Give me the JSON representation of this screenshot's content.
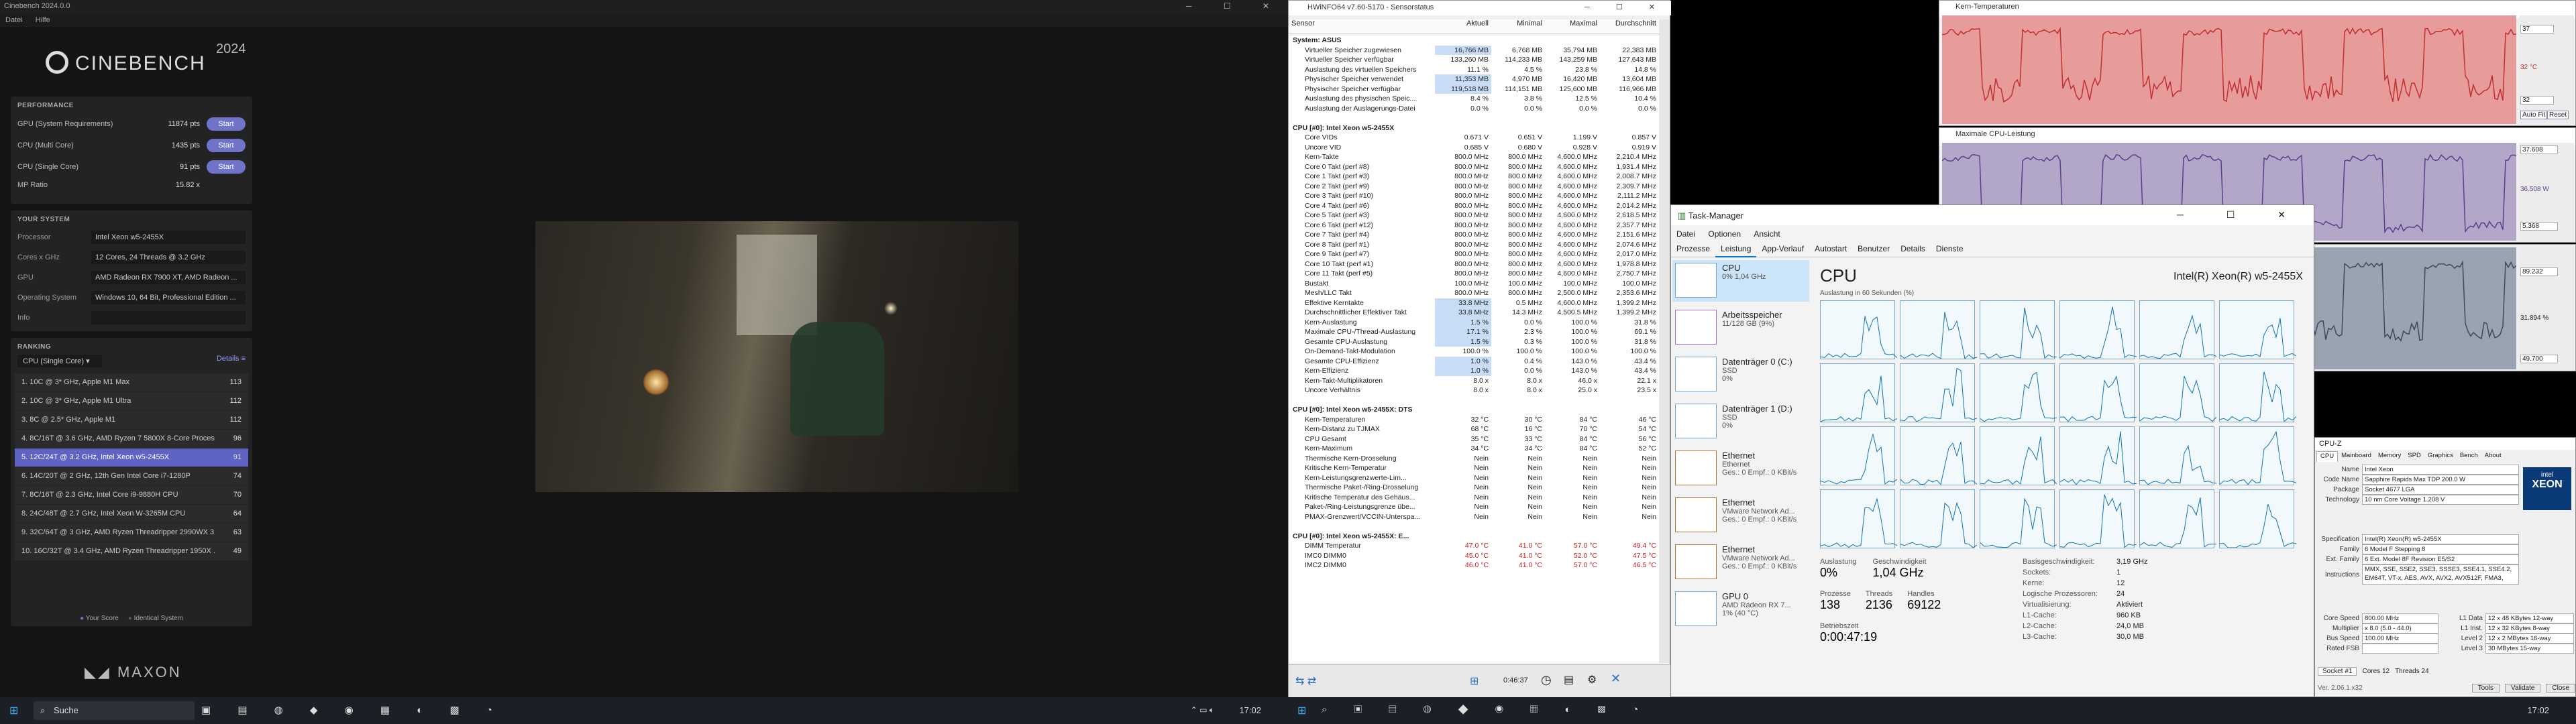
{
  "cinebench": {
    "title": "Cinebench 2024.0.0",
    "menu": [
      "Datei",
      "Hilfe"
    ],
    "logo": "CINEBENCH",
    "year": "2024",
    "performance": {
      "heading": "PERFORMANCE",
      "rows": [
        {
          "label": "GPU (System Requirements)",
          "value": "11874 pts",
          "button": "Start"
        },
        {
          "label": "CPU (Multi Core)",
          "value": "1435 pts",
          "button": "Start"
        },
        {
          "label": "CPU (Single Core)",
          "value": "91 pts",
          "button": "Start"
        },
        {
          "label": "MP Ratio",
          "value": "15.82 x",
          "button": ""
        }
      ]
    },
    "system": {
      "heading": "YOUR SYSTEM",
      "rows": [
        {
          "label": "Processor",
          "value": "Intel Xeon w5-2455X"
        },
        {
          "label": "Cores x GHz",
          "value": "12 Cores, 24 Threads @ 3.2 GHz"
        },
        {
          "label": "GPU",
          "value": "AMD Radeon RX 7900 XT, AMD Radeon ..."
        },
        {
          "label": "Operating System",
          "value": "Windows 10, 64 Bit, Professional Edition ..."
        },
        {
          "label": "Info",
          "value": ""
        }
      ]
    },
    "ranking": {
      "heading": "RANKING",
      "dropdown": "CPU (Single Core)",
      "details": "Details",
      "rows": [
        {
          "name": "1. 10C @ 3* GHz, Apple M1 Max",
          "score": "113"
        },
        {
          "name": "2. 10C @ 3* GHz, Apple M1 Ultra",
          "score": "112"
        },
        {
          "name": "3. 8C @ 2.5* GHz, Apple M1",
          "score": "112"
        },
        {
          "name": "4. 8C/16T @ 3.6 GHz, AMD Ryzen 7 5800X 8-Core Proces...",
          "score": "96"
        },
        {
          "name": "5. 12C/24T @ 3.2 GHz, Intel Xeon w5-2455X",
          "score": "91"
        },
        {
          "name": "6. 14C/20T @ 2 GHz, 12th Gen Intel Core i7-1280P",
          "score": "74"
        },
        {
          "name": "7. 8C/16T @ 2.3 GHz, Intel Core i9-9880H CPU",
          "score": "70"
        },
        {
          "name": "8. 24C/48T @ 2.7 GHz, Intel Xeon W-3265M CPU",
          "score": "64"
        },
        {
          "name": "9. 32C/64T @ 3 GHz, AMD Ryzen Threadripper 2990WX 3...",
          "score": "63"
        },
        {
          "name": "10. 16C/32T @ 3.4 GHz, AMD Ryzen Threadripper 1950X ...",
          "score": "49"
        }
      ],
      "legend_your": "Your Score",
      "legend_identical": "Identical System"
    },
    "brand": "MAXON"
  },
  "hwinfo": {
    "title": "HWiNFO64 v7.60-5170 - Sensorstatus",
    "columns": [
      "Sensor",
      "Aktuell",
      "Minimal",
      "Maximal",
      "Durchschnitt"
    ],
    "rows": [
      {
        "s": "System: ASUS",
        "a": "",
        "mi": "",
        "ma": "",
        "d": "",
        "g": true
      },
      {
        "s": "Virtueller Speicher zugewiesen",
        "a": "16,766 MB",
        "mi": "6,768 MB",
        "ma": "35,794 MB",
        "d": "22,383 MB"
      },
      {
        "s": "Virtueller Speicher verfügbar",
        "a": "133,260 MB",
        "mi": "114,233 MB",
        "ma": "143,259 MB",
        "d": "127,643 MB"
      },
      {
        "s": "Auslastung des virtuellen Speichers",
        "a": "11.1 %",
        "mi": "4.5 %",
        "ma": "23.8 %",
        "d": "14.8 %"
      },
      {
        "s": "Physischer Speicher verwendet",
        "a": "11,353 MB",
        "mi": "4,970 MB",
        "ma": "16,420 MB",
        "d": "13,604 MB"
      },
      {
        "s": "Physischer Speicher verfügbar",
        "a": "119,518 MB",
        "mi": "114,151 MB",
        "ma": "125,600 MB",
        "d": "116,966 MB"
      },
      {
        "s": "Auslastung des physischen Speic...",
        "a": "8.4 %",
        "mi": "3.8 %",
        "ma": "12.5 %",
        "d": "10.4 %"
      },
      {
        "s": "Auslastung der Auslagerungs-Datei",
        "a": "0.0 %",
        "mi": "0.0 %",
        "ma": "0.0 %",
        "d": "0.0 %"
      },
      {
        "s": "",
        "a": "",
        "mi": "",
        "ma": "",
        "d": ""
      },
      {
        "s": "CPU [#0]: Intel Xeon w5-2455X",
        "a": "",
        "mi": "",
        "ma": "",
        "d": "",
        "g": true
      },
      {
        "s": "Core VIDs",
        "a": "0.671 V",
        "mi": "0.651 V",
        "ma": "1.199 V",
        "d": "0.857 V"
      },
      {
        "s": "Uncore VID",
        "a": "0.685 V",
        "mi": "0.680 V",
        "ma": "0.928 V",
        "d": "0.919 V"
      },
      {
        "s": "Kern-Takte",
        "a": "800.0 MHz",
        "mi": "800.0 MHz",
        "ma": "4,600.0 MHz",
        "d": "2,210.4 MHz"
      },
      {
        "s": "Core 0 Takt (perf #8)",
        "a": "800.0 MHz",
        "mi": "800.0 MHz",
        "ma": "4,600.0 MHz",
        "d": "1,931.4 MHz"
      },
      {
        "s": "Core 1 Takt (perf #3)",
        "a": "800.0 MHz",
        "mi": "800.0 MHz",
        "ma": "4,600.0 MHz",
        "d": "2,008.7 MHz"
      },
      {
        "s": "Core 2 Takt (perf #9)",
        "a": "800.0 MHz",
        "mi": "800.0 MHz",
        "ma": "4,600.0 MHz",
        "d": "2,309.7 MHz"
      },
      {
        "s": "Core 3 Takt (perf #10)",
        "a": "800.0 MHz",
        "mi": "800.0 MHz",
        "ma": "4,600.0 MHz",
        "d": "2,111.2 MHz"
      },
      {
        "s": "Core 4 Takt (perf #6)",
        "a": "800.0 MHz",
        "mi": "800.0 MHz",
        "ma": "4,600.0 MHz",
        "d": "2,014.2 MHz"
      },
      {
        "s": "Core 5 Takt (perf #3)",
        "a": "800.0 MHz",
        "mi": "800.0 MHz",
        "ma": "4,600.0 MHz",
        "d": "2,618.5 MHz"
      },
      {
        "s": "Core 6 Takt (perf #12)",
        "a": "800.0 MHz",
        "mi": "800.0 MHz",
        "ma": "4,600.0 MHz",
        "d": "2,357.7 MHz"
      },
      {
        "s": "Core 7 Takt (perf #4)",
        "a": "800.0 MHz",
        "mi": "800.0 MHz",
        "ma": "4,600.0 MHz",
        "d": "2,151.6 MHz"
      },
      {
        "s": "Core 8 Takt (perf #1)",
        "a": "800.0 MHz",
        "mi": "800.0 MHz",
        "ma": "4,600.0 MHz",
        "d": "2,074.6 MHz"
      },
      {
        "s": "Core 9 Takt (perf #7)",
        "a": "800.0 MHz",
        "mi": "800.0 MHz",
        "ma": "4,600.0 MHz",
        "d": "2,017.0 MHz"
      },
      {
        "s": "Core 10 Takt (perf #1)",
        "a": "800.0 MHz",
        "mi": "800.0 MHz",
        "ma": "4,600.0 MHz",
        "d": "1,978.8 MHz"
      },
      {
        "s": "Core 11 Takt (perf #5)",
        "a": "800.0 MHz",
        "mi": "800.0 MHz",
        "ma": "4,600.0 MHz",
        "d": "2,750.7 MHz"
      },
      {
        "s": "Bustakt",
        "a": "100.0 MHz",
        "mi": "100.0 MHz",
        "ma": "100.0 MHz",
        "d": "100.0 MHz"
      },
      {
        "s": "Mesh/LLC Takt",
        "a": "800.0 MHz",
        "mi": "800.0 MHz",
        "ma": "2,500.0 MHz",
        "d": "2,353.6 MHz"
      },
      {
        "s": "Effektive Kerntakte",
        "a": "33.8 MHz",
        "mi": "0.5 MHz",
        "ma": "4,600.0 MHz",
        "d": "1,399.2 MHz"
      },
      {
        "s": "Durchschnittlicher Effektiver Takt",
        "a": "33.8 MHz",
        "mi": "14.3 MHz",
        "ma": "4,500.5 MHz",
        "d": "1,399.2 MHz"
      },
      {
        "s": "Kern-Auslastung",
        "a": "1.5 %",
        "mi": "0.0 %",
        "ma": "100.0 %",
        "d": "31.8 %"
      },
      {
        "s": "Maximale CPU-/Thread-Auslastung",
        "a": "17.1 %",
        "mi": "2.3 %",
        "ma": "100.0 %",
        "d": "69.1 %"
      },
      {
        "s": "Gesamte CPU-Auslastung",
        "a": "1.5 %",
        "mi": "0.3 %",
        "ma": "100.0 %",
        "d": "31.8 %"
      },
      {
        "s": "On-Demand-Takt-Modulation",
        "a": "100.0 %",
        "mi": "100.0 %",
        "ma": "100.0 %",
        "d": "100.0 %"
      },
      {
        "s": "Gesamte CPU-Effizienz",
        "a": "1.0 %",
        "mi": "0.4 %",
        "ma": "143.0 %",
        "d": "43.4 %"
      },
      {
        "s": "Kern-Effizienz",
        "a": "1.0 %",
        "mi": "0.0 %",
        "ma": "143.0 %",
        "d": "43.4 %"
      },
      {
        "s": "Kern-Takt-Multiplikatoren",
        "a": "8.0 x",
        "mi": "8.0 x",
        "ma": "46.0 x",
        "d": "22.1 x"
      },
      {
        "s": "Uncore Verhältnis",
        "a": "8.0 x",
        "mi": "8.0 x",
        "ma": "25.0 x",
        "d": "23.5 x"
      },
      {
        "s": "",
        "a": "",
        "mi": "",
        "ma": "",
        "d": ""
      },
      {
        "s": "CPU [#0]: Intel Xeon w5-2455X: DTS",
        "a": "",
        "mi": "",
        "ma": "",
        "d": "",
        "g": true
      },
      {
        "s": "Kern-Temperaturen",
        "a": "32 °C",
        "mi": "30 °C",
        "ma": "84 °C",
        "d": "46 °C"
      },
      {
        "s": "Kern-Distanz zu TJMAX",
        "a": "68 °C",
        "mi": "16 °C",
        "ma": "70 °C",
        "d": "54 °C"
      },
      {
        "s": "CPU Gesamt",
        "a": "35 °C",
        "mi": "33 °C",
        "ma": "84 °C",
        "d": "56 °C"
      },
      {
        "s": "Kern-Maximum",
        "a": "34 °C",
        "mi": "34 °C",
        "ma": "84 °C",
        "d": "52 °C"
      },
      {
        "s": "Thermische Kern-Drosselung",
        "a": "Nein",
        "mi": "Nein",
        "ma": "Nein",
        "d": "Nein"
      },
      {
        "s": "Kritische Kern-Temperatur",
        "a": "Nein",
        "mi": "Nein",
        "ma": "Nein",
        "d": "Nein"
      },
      {
        "s": "Kern-Leistungsgrenzwerte-Lim...",
        "a": "Nein",
        "mi": "Nein",
        "ma": "Nein",
        "d": "Nein"
      },
      {
        "s": "Thermische Paket-/Ring-Drosselung",
        "a": "Nein",
        "mi": "Nein",
        "ma": "Nein",
        "d": "Nein"
      },
      {
        "s": "Kritische Temperatur des Gehäus...",
        "a": "Nein",
        "mi": "Nein",
        "ma": "Nein",
        "d": "Nein"
      },
      {
        "s": "Paket-/Ring-Leistungsgrenze übe...",
        "a": "Nein",
        "mi": "Nein",
        "ma": "Nein",
        "d": "Nein"
      },
      {
        "s": "PMAX-Grenzwert/VCCIN-Unterspa...",
        "a": "Nein",
        "mi": "Nein",
        "ma": "Nein",
        "d": "Nein"
      },
      {
        "s": "",
        "a": "",
        "mi": "",
        "ma": "",
        "d": ""
      },
      {
        "s": "CPU [#0]: Intel Xeon w5-2455X: E...",
        "a": "",
        "mi": "",
        "ma": "",
        "d": "",
        "g": true
      },
      {
        "s": "DIMM Temperatur",
        "a": "47.0 °C",
        "mi": "41.0 °C",
        "ma": "57.0 °C",
        "d": "49.4 °C"
      },
      {
        "s": "IMC0 DIMM0",
        "a": "45.0 °C",
        "mi": "41.0 °C",
        "ma": "52.0 °C",
        "d": "47.5 °C"
      },
      {
        "s": "IMC2 DIMM0",
        "a": "46.0 °C",
        "mi": "41.0 °C",
        "ma": "57.0 °C",
        "d": "46.5 °C"
      }
    ],
    "timer": "0:46:37"
  },
  "taskmanager": {
    "title": "Task-Manager",
    "menu": [
      "Datei",
      "Optionen",
      "Ansicht"
    ],
    "tabs": [
      "Prozesse",
      "Leistung",
      "App-Verlauf",
      "Autostart",
      "Benutzer",
      "Details",
      "Dienste"
    ],
    "side": [
      {
        "name": "CPU",
        "sub1": "0% 1,04 GHz",
        "sub2": ""
      },
      {
        "name": "Arbeitsspeicher",
        "sub1": "11/128 GB (9%)",
        "sub2": ""
      },
      {
        "name": "Datenträger 0 (C:)",
        "sub1": "SSD",
        "sub2": "0%"
      },
      {
        "name": "Datenträger 1 (D:)",
        "sub1": "SSD",
        "sub2": "0%"
      },
      {
        "name": "Ethernet",
        "sub1": "Ethernet",
        "sub2": "Ges.: 0 Empf.: 0 KBit/s"
      },
      {
        "name": "Ethernet",
        "sub1": "VMware Network Ad...",
        "sub2": "Ges.: 0 Empf.: 0 KBit/s"
      },
      {
        "name": "Ethernet",
        "sub1": "VMware Network Ad...",
        "sub2": "Ges.: 0 Empf.: 0 KBit/s"
      },
      {
        "name": "GPU 0",
        "sub1": "AMD Radeon RX 7...",
        "sub2": "1% (40 °C)"
      }
    ],
    "cpu_label": "CPU",
    "cpu_name": "Intel(R) Xeon(R) w5-2455X",
    "graph_caption": "Auslastung in 60 Sekunden (%)",
    "stats": [
      {
        "k": "Auslastung",
        "v": "0%"
      },
      {
        "k": "Geschwindigkeit",
        "v": "1,04 GHz"
      }
    ],
    "stats2": [
      {
        "k": "Prozesse",
        "v": "138"
      },
      {
        "k": "Threads",
        "v": "2136"
      },
      {
        "k": "Handles",
        "v": "69122"
      }
    ],
    "uptime_label": "Betriebszeit",
    "uptime": "0:00:47:19",
    "details": [
      {
        "k": "Basisgeschwindigkeit:",
        "v": "3,19 GHz"
      },
      {
        "k": "Sockets:",
        "v": "1"
      },
      {
        "k": "Kerne:",
        "v": "12"
      },
      {
        "k": "Logische Prozessoren:",
        "v": "24"
      },
      {
        "k": "Virtualisierung:",
        "v": "Aktiviert"
      },
      {
        "k": "L1-Cache:",
        "v": "960 KB"
      },
      {
        "k": "L2-Cache:",
        "v": "24,0 MB"
      },
      {
        "k": "L3-Cache:",
        "v": "30,0 MB"
      }
    ]
  },
  "graphs": {
    "g1": {
      "title": "Kern-Temperaturen",
      "max": "37",
      "val": "32 °C",
      "min": "32",
      "auto": "Auto Fit",
      "reset": "Reset"
    },
    "g2": {
      "title": "Maximale CPU-Leistung",
      "max": "37.608",
      "val": "36.508 W",
      "min": "5.368",
      "auto": "Auto Fit",
      "reset": "Reset"
    },
    "g3": {
      "max": "89.232",
      "val": "31.894 %",
      "min": "49.700",
      "auto": "Auto Fit",
      "reset": "Reset"
    }
  },
  "cpuz": {
    "title": "CPU-Z",
    "tabs": [
      "CPU",
      "Mainboard",
      "Memory",
      "SPD",
      "Graphics",
      "Bench",
      "About"
    ],
    "processor": [
      {
        "k": "Name",
        "v": "Intel Xeon"
      },
      {
        "k": "Code Name",
        "v": "Sapphire Rapids     Max TDP 200.0 W"
      },
      {
        "k": "Package",
        "v": "Socket 4677 LGA"
      },
      {
        "k": "Technology",
        "v": "10 nm     Core Voltage 1.208 V"
      },
      {
        "k": "Specification",
        "v": "Intel(R) Xeon(R) w5-2455X"
      },
      {
        "k": "Family",
        "v": "6     Model F     Stepping 8"
      },
      {
        "k": "Ext. Family",
        "v": "6     Ext. Model 8F     Revision E5/S2"
      },
      {
        "k": "Instructions",
        "v": "MMX, SSE, SSE2, SSE3, SSSE3, SSE4.1, SSE4.2, EM64T, VT-x, AES, AVX, AVX2, AVX512F, FMA3, TSX, SHA, AMX"
      }
    ],
    "clocks": [
      {
        "k": "Core Speed",
        "v": "800.00 MHz"
      },
      {
        "k": "Multiplier",
        "v": "x 8.0 (5.0 - 44.0)"
      },
      {
        "k": "Bus Speed",
        "v": "100.00 MHz"
      },
      {
        "k": "Rated FSB",
        "v": ""
      }
    ],
    "cache": [
      {
        "k": "L1 Data",
        "v": "12 x 48 KBytes  12-way"
      },
      {
        "k": "L1 Inst.",
        "v": "12 x 32 KBytes  8-way"
      },
      {
        "k": "Level 2",
        "v": "12 x 2 MBytes  16-way"
      },
      {
        "k": "Level 3",
        "v": "30 MBytes  15-way"
      }
    ],
    "selection": "Socket #1",
    "cores": "Cores 12",
    "threads": "Threads 24",
    "version": "Ver. 2.06.1.x32",
    "tools": "Tools",
    "validate": "Validate",
    "close": "Close",
    "logo": "XEON"
  },
  "taskbar_left": {
    "search": "Suche",
    "time": "17:02"
  },
  "taskbar_right": {
    "time": "17:02"
  }
}
